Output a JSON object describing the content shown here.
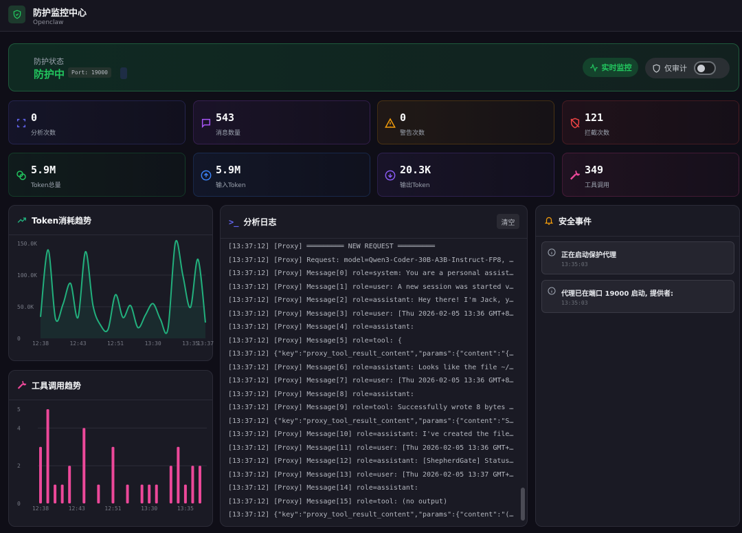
{
  "header": {
    "title": "防护监控中心",
    "subtitle": "Openclaw"
  },
  "status": {
    "label": "防护状态",
    "value": "防护中",
    "port": "Port: 19000",
    "live_button": "实时监控",
    "audit_label": "仅审计",
    "audit_only": false,
    "accent": "#22c55e"
  },
  "stats": [
    {
      "value": "0",
      "label": "分析次数",
      "icon": "scan-icon",
      "color": "#6366f1"
    },
    {
      "value": "543",
      "label": "消息数量",
      "icon": "message-icon",
      "color": "#a855f7"
    },
    {
      "value": "0",
      "label": "警告次数",
      "icon": "warning-icon",
      "color": "#f59e0b"
    },
    {
      "value": "121",
      "label": "拦截次数",
      "icon": "shield-off-icon",
      "color": "#ef4444"
    },
    {
      "value": "5.9M",
      "label": "Token总量",
      "icon": "coins-icon",
      "color": "#22c55e"
    },
    {
      "value": "5.9M",
      "label": "输入Token",
      "icon": "arrow-up-circle-icon",
      "color": "#3b82f6"
    },
    {
      "value": "20.3K",
      "label": "输出Token",
      "icon": "arrow-down-circle-icon",
      "color": "#8b5cf6"
    },
    {
      "value": "349",
      "label": "工具调用",
      "icon": "wrench-icon",
      "color": "#ec4899"
    }
  ],
  "token_panel": {
    "title": "Token消耗趋势"
  },
  "tool_panel": {
    "title": "工具调用趋势"
  },
  "chart_data": [
    {
      "type": "area",
      "x_ticks": [
        "12:38",
        "12:43",
        "12:51",
        "13:30",
        "13:35",
        "13:37"
      ],
      "y_ticks": [
        "0",
        "50.0K",
        "100.0K",
        "150.0K"
      ],
      "ylim": [
        0,
        150000
      ],
      "values": [
        34000,
        140000,
        31000,
        54000,
        87000,
        33000,
        137000,
        52000,
        21000,
        14000,
        69000,
        33000,
        52000,
        17000,
        37000,
        55000,
        30000,
        15000,
        152000,
        99000,
        49000,
        125000,
        25000
      ],
      "color": "#22b07d",
      "grid": true
    },
    {
      "type": "bar",
      "x_ticks": [
        "12:38",
        "12:43",
        "12:51",
        "13:30",
        "13:35"
      ],
      "y_ticks": [
        "0",
        "2",
        "4",
        "5"
      ],
      "ylim": [
        0,
        5
      ],
      "values": [
        3,
        5,
        1,
        1,
        2,
        0,
        4,
        0,
        1,
        0,
        3,
        0,
        1,
        0,
        1,
        1,
        1,
        0,
        2,
        3,
        1,
        2,
        2
      ],
      "color": "#ec4899",
      "grid": true
    }
  ],
  "log_panel": {
    "title": "分析日志",
    "clear_button": "清空",
    "lines": [
      "[13:37:12] [Proxy] ═════════ NEW REQUEST ═════════",
      "[13:37:12] [Proxy] Request: model=Qwen3-Coder-30B-A3B-Instruct-FP8, m…",
      "[13:37:12] [Proxy] Message[0] role=system: You are a personal assista…",
      "[13:37:12] [Proxy] Message[1] role=user: A new session was started vi…",
      "[13:37:12] [Proxy] Message[2] role=assistant: Hey there! I'm Jack, yo…",
      "[13:37:12] [Proxy] Message[3] role=user: [Thu 2026-02-05 13:36 GMT+8]…",
      "[13:37:12] [Proxy] Message[4] role=assistant:",
      "[13:37:12] [Proxy] Message[5] role=tool: {",
      "[13:37:12] {\"key\":\"proxy_tool_result_content\",\"params\":{\"content\":\"{\\…",
      "[13:37:12] [Proxy] Message[6] role=assistant: Looks like the file ~/1…",
      "[13:37:12] [Proxy] Message[7] role=user: [Thu 2026-02-05 13:36 GMT+8]…",
      "[13:37:12] [Proxy] Message[8] role=assistant:",
      "[13:37:12] [Proxy] Message[9] role=tool: Successfully wrote 8 bytes t…",
      "[13:37:12] {\"key\":\"proxy_tool_result_content\",\"params\":{\"content\":\"Su…",
      "[13:37:12] [Proxy] Message[10] role=assistant: I've created the file …",
      "[13:37:12] [Proxy] Message[11] role=user: [Thu 2026-02-05 13:36 GMT+8…",
      "[13:37:12] [Proxy] Message[12] role=assistant: [ShepherdGate] Status:…",
      "[13:37:12] [Proxy] Message[13] role=user: [Thu 2026-02-05 13:37 GMT+8…",
      "[13:37:12] [Proxy] Message[14] role=assistant:",
      "[13:37:12] [Proxy] Message[15] role=tool: (no output)",
      "[13:37:12] {\"key\":\"proxy_tool_result_content\",\"params\":{\"content\":\"(n…"
    ]
  },
  "events_panel": {
    "title": "安全事件",
    "events": [
      {
        "text": "正在启动保护代理",
        "time": "13:35:03"
      },
      {
        "text": "代理已在端口 19000 启动, 提供者:",
        "time": "13:35:03"
      }
    ]
  }
}
